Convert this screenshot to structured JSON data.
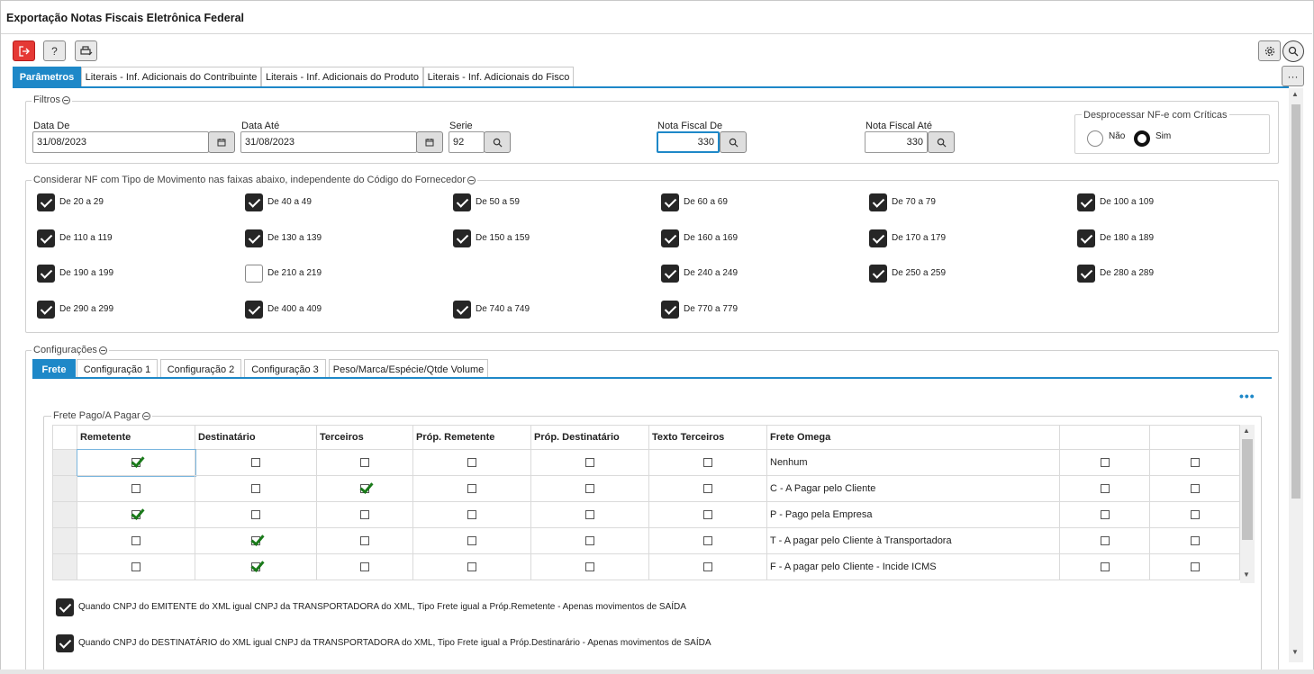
{
  "window": {
    "title": "Exportação Notas Fiscais Eletrônica Federal"
  },
  "toolbar": {
    "exit_icon": "exit-icon",
    "help_label": "?",
    "print_icon": "printer-icon",
    "settings_icon": "gear-icon",
    "search_icon": "search-icon",
    "more_label": "···"
  },
  "tabs": [
    "Parâmetros",
    "Literais - Inf. Adicionais do Contribuinte",
    "Literais - Inf. Adicionais do Produto",
    "Literais - Inf. Adicionais do Fisco"
  ],
  "filtros": {
    "label": "Filtros",
    "data_de": {
      "label": "Data De",
      "value": "31/08/2023"
    },
    "data_ate": {
      "label": "Data Até",
      "value": "31/08/2023"
    },
    "serie": {
      "label": "Serie",
      "value": "92"
    },
    "nf_de": {
      "label": "Nota Fiscal De",
      "value": "330"
    },
    "nf_ate": {
      "label": "Nota Fiscal Até",
      "value": "330"
    },
    "desprocessar": {
      "label": "Desprocessar NF-e com Críticas",
      "nao": "Não",
      "sim": "Sim",
      "selected": "Sim"
    }
  },
  "movimento": {
    "label": "Considerar NF com Tipo de Movimento nas faixas abaixo, independente do Código do Fornecedor",
    "rows": [
      [
        {
          "label": "De 20 a 29",
          "checked": true
        },
        {
          "label": "De 40 a 49",
          "checked": true
        },
        {
          "label": "De 50 a 59",
          "checked": true
        },
        {
          "label": "De 60 a 69",
          "checked": true
        },
        {
          "label": "De 70 a 79",
          "checked": true
        },
        {
          "label": "De 100 a 109",
          "checked": true
        }
      ],
      [
        {
          "label": "De 110 a 119",
          "checked": true
        },
        {
          "label": "De 130 a 139",
          "checked": true
        },
        {
          "label": "De 150 a 159",
          "checked": true
        },
        {
          "label": "De 160 a 169",
          "checked": true
        },
        {
          "label": "De 170 a 179",
          "checked": true
        },
        {
          "label": "De 180 a 189",
          "checked": true
        }
      ],
      [
        {
          "label": "De 190 a 199",
          "checked": true
        },
        {
          "label": "De 210 a 219",
          "checked": false
        },
        null,
        {
          "label": "De 240 a 249",
          "checked": true
        },
        {
          "label": "De 250 a 259",
          "checked": true
        },
        {
          "label": "De 280 a 289",
          "checked": true
        }
      ],
      [
        {
          "label": "De 290 a 299",
          "checked": true
        },
        {
          "label": "De 400 a 409",
          "checked": true
        },
        {
          "label": "De 740 a 749",
          "checked": true
        },
        {
          "label": "De 770 a 779",
          "checked": true
        },
        null,
        null
      ]
    ]
  },
  "configuracoes": {
    "label": "Configurações",
    "tabs": [
      "Frete",
      "Configuração 1",
      "Configuração 2",
      "Configuração 3",
      "Peso/Marca/Espécie/Qtde Volume"
    ],
    "more": "•••",
    "frete": {
      "label": "Frete Pago/A Pagar",
      "columns": [
        "Remetente",
        "Destinatário",
        "Terceiros",
        "Próp. Remetente",
        "Próp. Destinatário",
        "Texto Terceiros",
        "Frete Omega",
        "",
        ""
      ],
      "rows": [
        {
          "checks": [
            true,
            false,
            false,
            false,
            false,
            false
          ],
          "text": "Nenhum",
          "extra": [
            false,
            false
          ]
        },
        {
          "checks": [
            false,
            false,
            true,
            false,
            false,
            false
          ],
          "text": "C - A Pagar pelo Cliente",
          "extra": [
            false,
            false
          ]
        },
        {
          "checks": [
            true,
            false,
            false,
            false,
            false,
            false
          ],
          "text": "P - Pago pela Empresa",
          "extra": [
            false,
            false
          ]
        },
        {
          "checks": [
            false,
            true,
            false,
            false,
            false,
            false
          ],
          "text": "T - A pagar pelo Cliente à Transportadora",
          "extra": [
            false,
            false
          ]
        },
        {
          "checks": [
            false,
            true,
            false,
            false,
            false,
            false
          ],
          "text": "F - A pagar pelo Cliente - Incide ICMS",
          "extra": [
            false,
            false
          ]
        }
      ]
    },
    "options": [
      {
        "label": "Quando CNPJ do EMITENTE do XML igual CNPJ da TRANSPORTADORA do XML, Tipo Frete igual a Próp.Remetente - Apenas movimentos de SAÍDA",
        "checked": true
      },
      {
        "label": "Quando CNPJ do DESTINATÁRIO do XML igual CNPJ da TRANSPORTADORA do XML, Tipo Frete igual a Próp.Destinarário - Apenas movimentos de SAÍDA",
        "checked": true
      }
    ]
  },
  "colors": {
    "accent": "#1e88c8",
    "danger": "#e53935",
    "check_green": "#1a7a1a"
  }
}
